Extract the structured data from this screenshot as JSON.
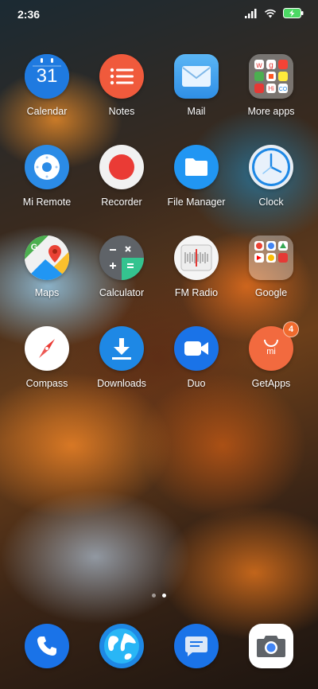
{
  "status_bar": {
    "time": "2:36"
  },
  "apps": [
    [
      {
        "name": "calendar",
        "label": "Calendar",
        "day": "31"
      },
      {
        "name": "notes",
        "label": "Notes"
      },
      {
        "name": "mail",
        "label": "Mail"
      },
      {
        "name": "more-apps",
        "label": "More apps"
      }
    ],
    [
      {
        "name": "mi-remote",
        "label": "Mi Remote"
      },
      {
        "name": "recorder",
        "label": "Recorder"
      },
      {
        "name": "file-manager",
        "label": "File Manager"
      },
      {
        "name": "clock",
        "label": "Clock"
      }
    ],
    [
      {
        "name": "maps",
        "label": "Maps"
      },
      {
        "name": "calculator",
        "label": "Calculator"
      },
      {
        "name": "fm-radio",
        "label": "FM Radio"
      },
      {
        "name": "google",
        "label": "Google"
      }
    ],
    [
      {
        "name": "compass",
        "label": "Compass"
      },
      {
        "name": "downloads",
        "label": "Downloads"
      },
      {
        "name": "duo",
        "label": "Duo"
      },
      {
        "name": "getapps",
        "label": "GetApps",
        "badge": "4"
      }
    ]
  ],
  "dock": [
    {
      "name": "phone"
    },
    {
      "name": "browser"
    },
    {
      "name": "messages"
    },
    {
      "name": "camera"
    }
  ],
  "page_indicator": {
    "pages": 2,
    "active": 2
  },
  "colors": {
    "calendar": "#1f7ae0",
    "notes": "#f05a3c",
    "mail": "#3aa0ef",
    "mi_remote": "#2b8be6",
    "recorder": "#ea3b35",
    "file_manager": "#2196f3",
    "clock": "#1e88e5",
    "downloads": "#1e88e5",
    "duo": "#1a73e8",
    "getapps": "#f26a3f",
    "phone": "#1a73e8"
  }
}
